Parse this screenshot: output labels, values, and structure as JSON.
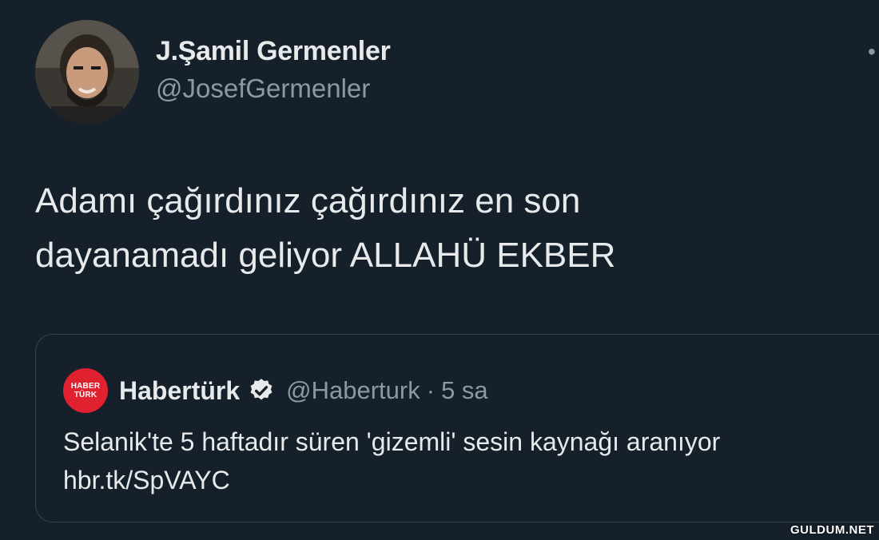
{
  "tweet": {
    "author_name": "J.Şamil Germenler",
    "author_handle": "@JosefGermenler",
    "text": "Adamı çağırdınız çağırdınız en son\ndayanamadı geliyor ALLAHÜ EKBER",
    "more_icon": "more-icon"
  },
  "quote": {
    "avatar_line1": "HABER",
    "avatar_line2": "TÜRK",
    "author_name": "Habertürk",
    "verified_icon": "verified-badge-icon",
    "author_handle": "@Haberturk",
    "separator": "·",
    "time": "5 sa",
    "text": "Selanik'te 5 haftadır süren 'gizemli' sesin kaynağı aranıyor",
    "link": "hbr.tk/SpVAYC"
  },
  "watermark": "GULDUM.NET",
  "colors": {
    "background": "#15202b",
    "primary_text": "#e7e9ea",
    "secondary_text": "#8b98a5",
    "border": "#38444d",
    "brand_red": "#e0212f"
  }
}
